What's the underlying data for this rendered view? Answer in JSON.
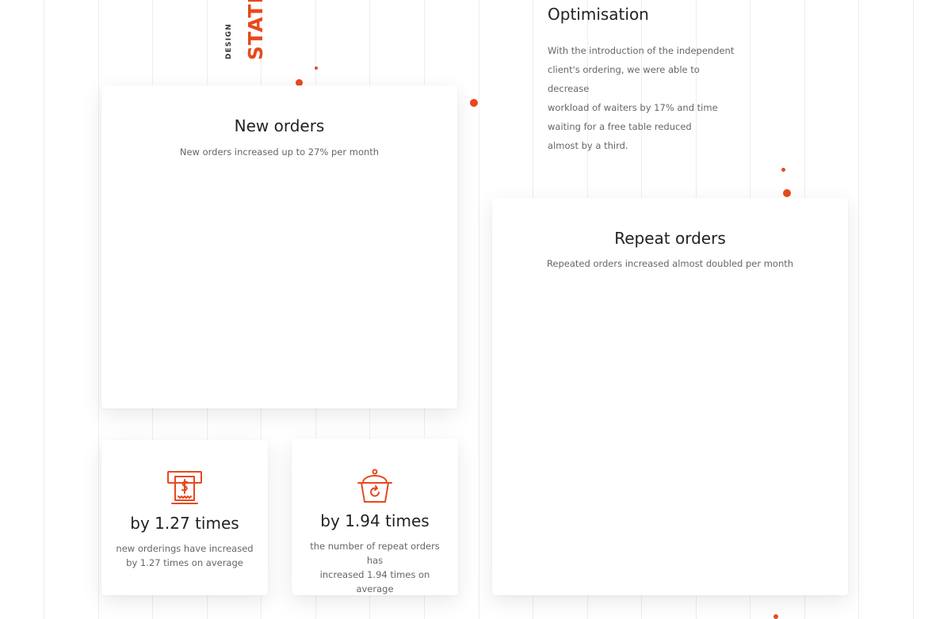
{
  "side_labels": {
    "design": "DESIGN",
    "stats": "STATIS"
  },
  "optimisation": {
    "title": "Optimisation",
    "text": "With the introduction of the independent\nclient's ordering, we were able to decrease\nworkload of waiters by 17% and time\nwaiting for a free table reduced\nalmost by a third."
  },
  "new_orders": {
    "title": "New orders",
    "subtitle": "New orders increased up to 27% per month"
  },
  "repeat_orders": {
    "title": "Repeat orders",
    "subtitle": "Repeated orders increased almost doubled per month"
  },
  "stats": [
    {
      "icon": "cash-register-icon",
      "title": "by 1.27 times",
      "description": "new orderings have increased\nby 1.27 times on average"
    },
    {
      "icon": "repeat-basket-icon",
      "title": "by 1.94 times",
      "description": "the number of repeat orders has\nincreased 1.94 times on average"
    }
  ],
  "colors": {
    "accent": "#e8491d",
    "text": "#222222",
    "muted": "#666666"
  }
}
